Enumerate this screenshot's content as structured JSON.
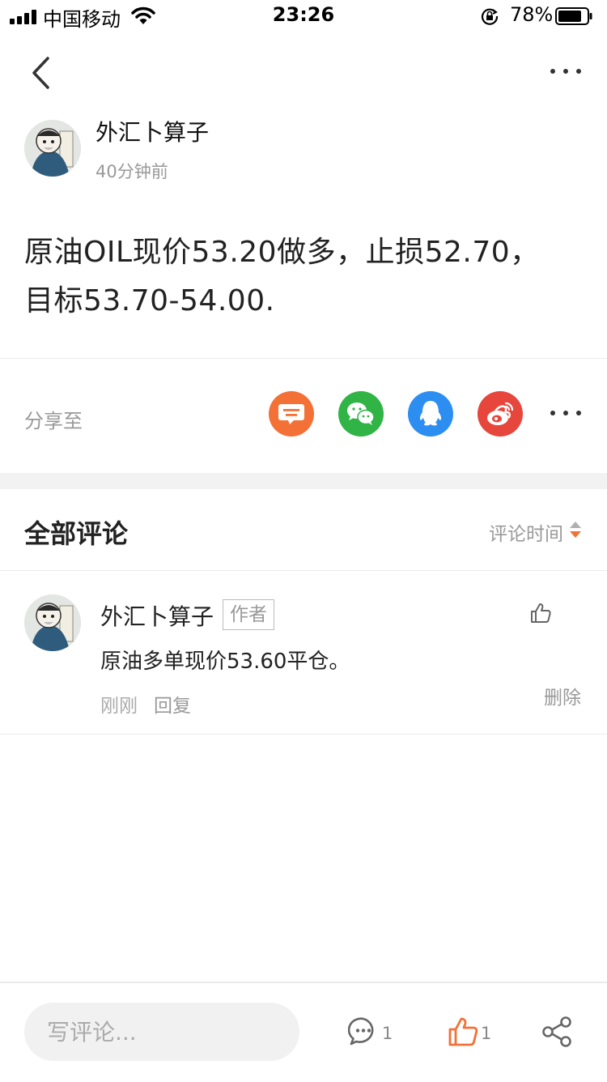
{
  "status_bar": {
    "carrier": "中国移动",
    "time": "23:26",
    "battery": "78%"
  },
  "post": {
    "author": "外汇卜算子",
    "time": "40分钟前",
    "content": "原油OIL现价53.20做多，止损52.70，\n目标53.70-54.00."
  },
  "share": {
    "label": "分享至",
    "targets": [
      {
        "name": "message",
        "color": "#f37036"
      },
      {
        "name": "wechat",
        "color": "#2fb445"
      },
      {
        "name": "qq",
        "color": "#2d8ef2"
      },
      {
        "name": "weibo",
        "color": "#e6463c"
      }
    ]
  },
  "comments_section": {
    "title": "全部评论",
    "sort_label": "评论时间",
    "accent": "#f37036"
  },
  "comments": [
    {
      "author": "外汇卜算子",
      "badge": "作者",
      "text": "原油多单现价53.60平仓。",
      "time": "刚刚",
      "reply": "回复",
      "delete": "删除"
    }
  ],
  "bottom_bar": {
    "placeholder": "写评论...",
    "comment_count": "1",
    "like_count": "1"
  }
}
